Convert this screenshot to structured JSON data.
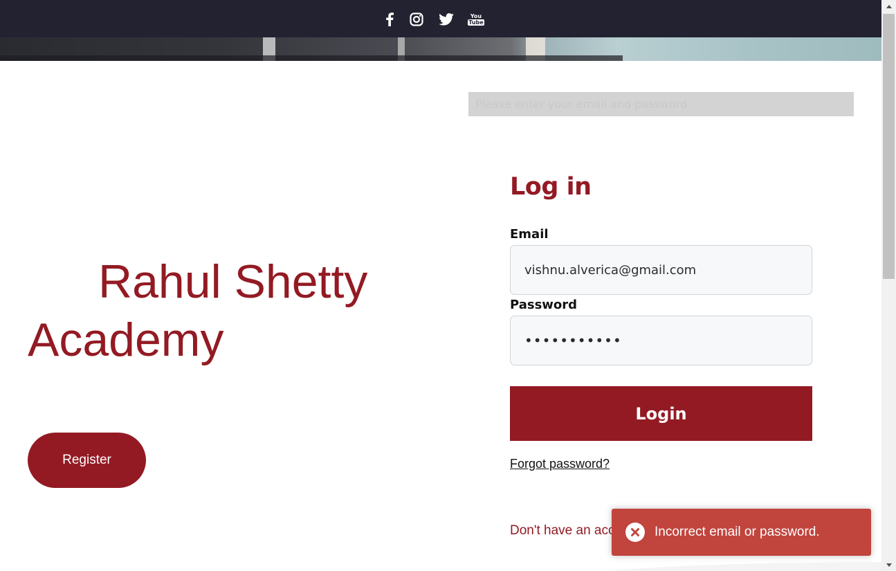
{
  "header": {
    "social": [
      {
        "name": "facebook-icon"
      },
      {
        "name": "instagram-icon"
      },
      {
        "name": "twitter-icon"
      },
      {
        "name": "youtube-icon",
        "glyph_top": "You",
        "glyph_bottom": "Tube"
      }
    ]
  },
  "notice": {
    "text": "Please enter your email and password"
  },
  "brand": {
    "title": "Rahul Shetty Academy"
  },
  "register": {
    "label": "Register"
  },
  "login": {
    "title": "Log in",
    "email_label": "Email",
    "email_value": "vishnu.alverica@gmail.com",
    "password_label": "Password",
    "password_value": "•••••••••••",
    "button_label": "Login",
    "forgot_label": "Forgot password?",
    "signup_text": "Don't have an acco"
  },
  "toast": {
    "message": "Incorrect email or password.",
    "icon": "close-circle-icon"
  },
  "colors": {
    "brand": "#931a23",
    "topbar": "#222231",
    "toast": "#c1443d"
  }
}
